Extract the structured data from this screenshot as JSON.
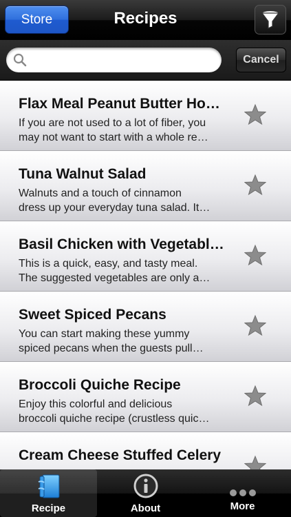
{
  "navbar": {
    "store_label": "Store",
    "title": "Recipes",
    "filter_icon": "funnel-icon"
  },
  "search": {
    "value": "",
    "placeholder": "",
    "cancel_label": "Cancel"
  },
  "recipes": [
    {
      "title": "Flax Meal Peanut Butter Ho…",
      "desc1": "If you are not used to a lot of fiber, you",
      "desc2": "may not want to start with a whole re…"
    },
    {
      "title": "Tuna Walnut Salad",
      "desc1": "Walnuts and a touch of cinnamon",
      "desc2": "dress up your everyday tuna salad. It…"
    },
    {
      "title": "Basil Chicken with Vegetabl…",
      "desc1": "This is a quick, easy, and tasty meal.",
      "desc2": "The suggested vegetables are only a…"
    },
    {
      "title": "Sweet Spiced Pecans",
      "desc1": "You can start making these yummy",
      "desc2": "spiced pecans when the guests pull…"
    },
    {
      "title": "Broccoli Quiche Recipe",
      "desc1": "Enjoy this colorful and delicious",
      "desc2": "broccoli quiche recipe (crustless quic…"
    },
    {
      "title": "Cream Cheese Stuffed Celery",
      "desc1": "",
      "desc2": ""
    }
  ],
  "tabs": [
    {
      "label": "Recipe",
      "icon": "recipe-book-icon",
      "active": true
    },
    {
      "label": "About",
      "icon": "info-icon",
      "active": false
    },
    {
      "label": "More",
      "icon": "more-dots-icon",
      "active": false
    }
  ],
  "colors": {
    "store_blue": "#2f6fdc",
    "star_gray": "#8c8c8c"
  }
}
